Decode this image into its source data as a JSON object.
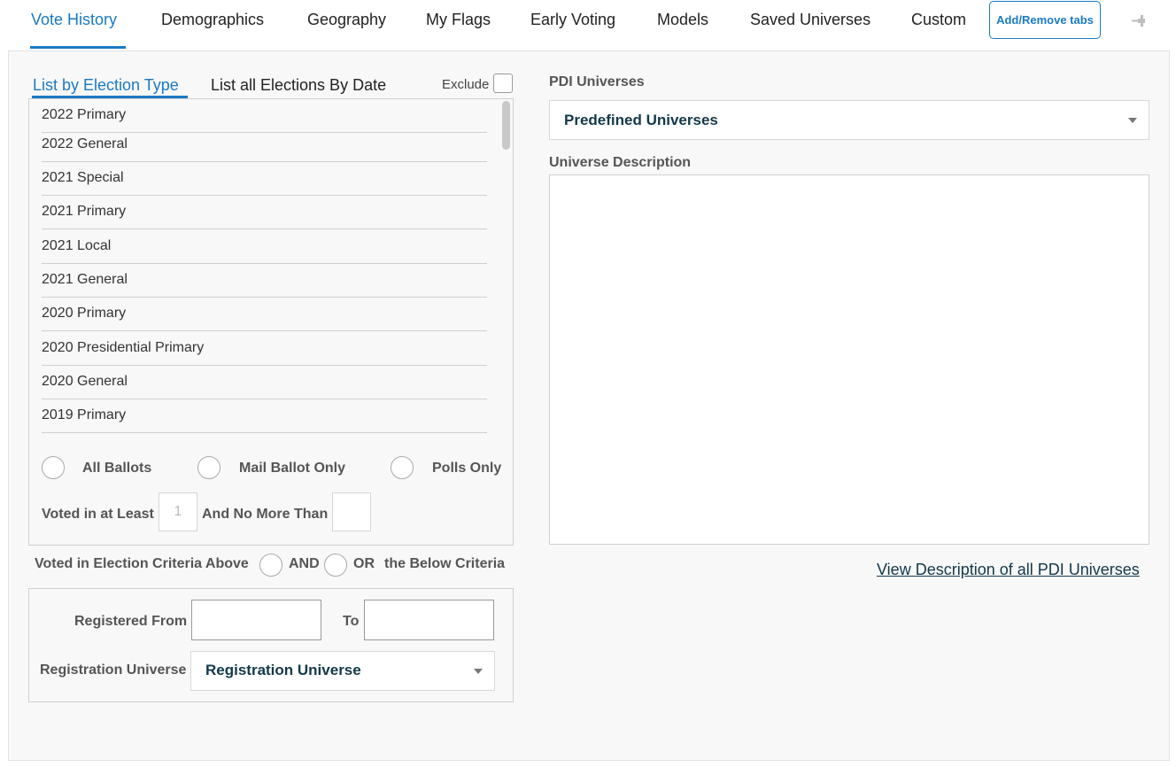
{
  "tabs": [
    {
      "label": "Vote History",
      "active": true
    },
    {
      "label": "Demographics"
    },
    {
      "label": "Geography"
    },
    {
      "label": "My Flags"
    },
    {
      "label": "Early Voting"
    },
    {
      "label": "Models"
    },
    {
      "label": "Saved Universes"
    },
    {
      "label": "Custom"
    }
  ],
  "add_remove_tabs_label": "Add/Remove tabs",
  "pin_icon": "pin-icon",
  "subtabs": {
    "by_type": "List by Election Type",
    "by_date": "List all Elections By Date"
  },
  "exclude_label": "Exclude",
  "elections": [
    "2022 Primary",
    "2022 General",
    "2021 Special",
    "2021 Primary",
    "2021 Local",
    "2021 General",
    "2020 Primary",
    "2020 Presidential Primary",
    "2020 General",
    "2019 Primary"
  ],
  "ballots": {
    "all": "All Ballots",
    "mail": "Mail Ballot Only",
    "polls": "Polls Only"
  },
  "voted_at_least_label": "Voted in at Least",
  "voted_at_least_placeholder": "1",
  "no_more_than_label": "And No More Than",
  "criteria": {
    "prefix": "Voted in Election Criteria Above",
    "and": "AND",
    "or": "OR",
    "suffix": "the Below Criteria"
  },
  "registration": {
    "from_label": "Registered From",
    "to_label": "To",
    "universe_label": "Registration Universe",
    "universe_value": "Registration Universe"
  },
  "pdi": {
    "label": "PDI Universes",
    "select_value": "Predefined Universes",
    "description_label": "Universe Description",
    "view_link": "View Description of all PDI Universes"
  },
  "colors": {
    "accent": "#1a7ac4",
    "select_text": "#13394a"
  }
}
